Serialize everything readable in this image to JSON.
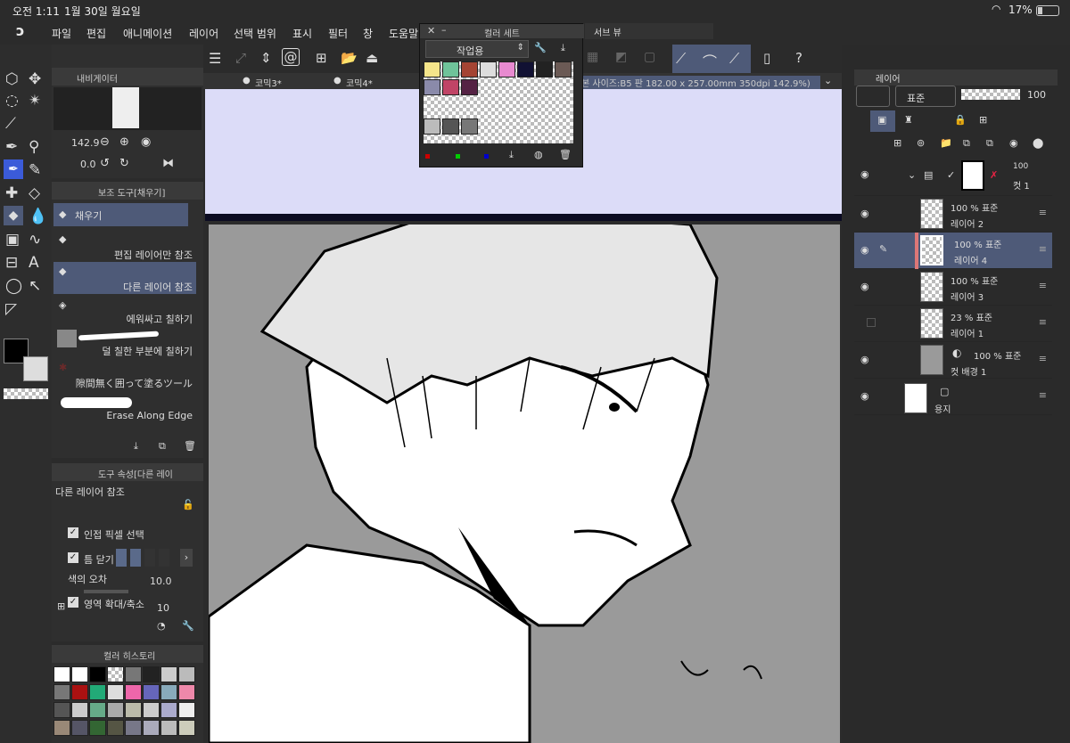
{
  "status": {
    "time": "오전 1:11",
    "date": "1월 30일 월요일",
    "battery": "17%"
  },
  "menu": [
    "파일",
    "편집",
    "애니메이션",
    "레이어",
    "선택 범위",
    "표시",
    "필터",
    "창",
    "도움말"
  ],
  "navigator": {
    "title": "내비게이터",
    "zoom": "142.9",
    "rotation": "0.0"
  },
  "subtool": {
    "title": "보조 도구[채우기]",
    "items": [
      "채우기",
      "편집 레이어만 참조",
      "다른 레이어 참조",
      "에워싸고 칠하기",
      "덜 칠한 부분에 칠하기",
      "隙間無く囲って塗るツール",
      "Erase Along Edge"
    ]
  },
  "tool_property": {
    "title": "도구 속성[다른 레이",
    "name": "다른 레이어 참조",
    "adjacent_pixel": "인접 픽셀 선택",
    "close_gap": "틈 닫기",
    "color_margin_label": "색의 오차",
    "color_margin_value": "10.0",
    "area_scale_label": "영역 확대/축소",
    "area_scale_value": "10"
  },
  "color_history": {
    "title": "컬러 히스토리"
  },
  "color_set": {
    "title": "컬러 세트",
    "preset": "작업용",
    "subview": "서브 뷰"
  },
  "tabs": [
    "코믹3*",
    "코믹4*"
  ],
  "canvas_info": "본 사이즈:B5 판 182.00 x 257.00mm 350dpi 142.9%)",
  "layers": {
    "tab": "레이어",
    "blend": "표준",
    "opacity": "100",
    "items": [
      {
        "percent": "100",
        "name": "컷 1"
      },
      {
        "percent": "100 % 표준",
        "name": "레이어 2"
      },
      {
        "percent": "100 % 표준",
        "name": "레이어 4"
      },
      {
        "percent": "100 % 표준",
        "name": "레이어 3"
      },
      {
        "percent": "23 % 표준",
        "name": "레이어 1"
      },
      {
        "percent": "100 % 표준",
        "name": "컷 배경 1"
      },
      {
        "percent": "",
        "name": "용지"
      }
    ]
  },
  "colors": {
    "accent": "#4e5a78",
    "canvas_top": "#dcdcf8",
    "canvas_bg": "#9a9a9a"
  }
}
